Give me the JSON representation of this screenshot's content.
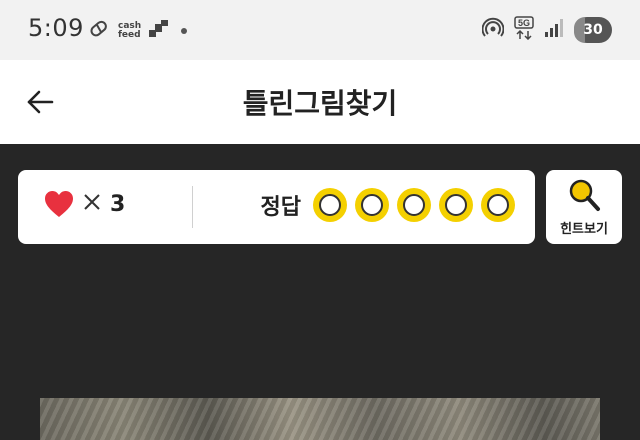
{
  "status_bar": {
    "time": "5:09",
    "cashfeed_label": "cash\nfeed",
    "battery": "30"
  },
  "header": {
    "title": "틀린그림찾기"
  },
  "game": {
    "lives_symbol": "×",
    "lives_count": "3",
    "answer_label": "정답",
    "answer_slots_total": 5,
    "answer_slots_found": 0,
    "hint_label": "힌트보기"
  },
  "colors": {
    "heart": "#e8313f",
    "slot_fill": "#f4d000",
    "hint_icon": "#f2c500",
    "game_background": "#262626"
  }
}
